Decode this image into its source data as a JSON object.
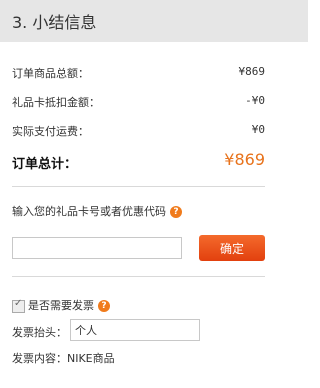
{
  "header": {
    "title": "3. 小结信息"
  },
  "summary": {
    "rows": [
      {
        "label": "订单商品总额：",
        "value": "¥869"
      },
      {
        "label": "礼品卡抵扣金额：",
        "value": "-¥0"
      },
      {
        "label": "实际支付运费：",
        "value": "¥0"
      }
    ],
    "total_label": "订单总计：",
    "total_value": "¥869"
  },
  "promo": {
    "label": "输入您的礼品卡号或者优惠代码",
    "help_icon": "?",
    "input_value": "",
    "confirm_label": "确定"
  },
  "invoice": {
    "checkbox_label": "是否需要发票",
    "checked": true,
    "help_icon": "?",
    "title_label": "发票抬头：",
    "title_value": "个人",
    "content_label": "发票内容：",
    "content_value": "NIKE商品"
  },
  "colors": {
    "accent": "#e8731c",
    "button": "#e2400e",
    "header_bg": "#e6e6e6"
  }
}
